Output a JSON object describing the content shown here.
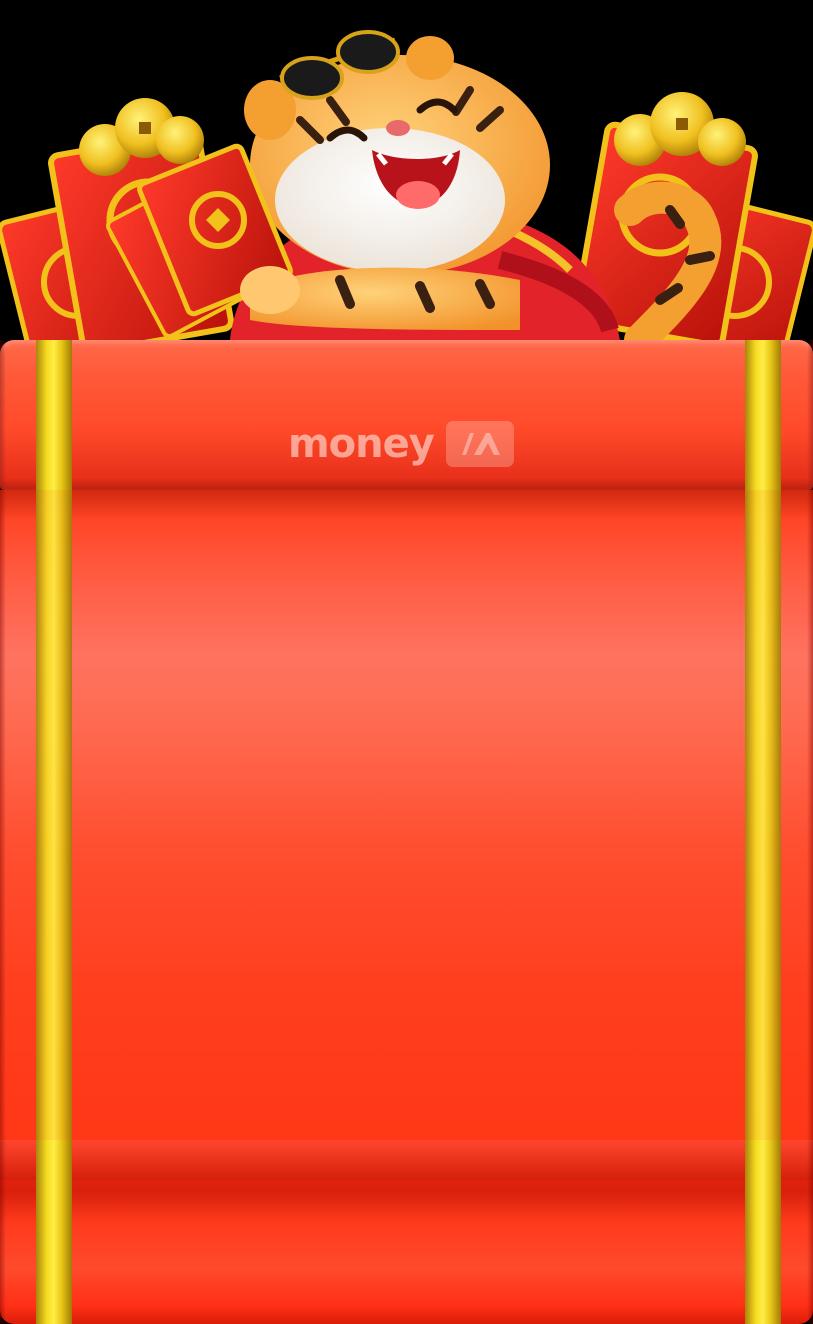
{
  "brand": {
    "word": "money",
    "badge_letters": "IA",
    "word_color": "#ffe8e0"
  },
  "colors": {
    "scroll_red": "#ff4a2a",
    "gold": "#f6dc22",
    "background": "#000000"
  },
  "icons": {
    "mascot": "tiger-icon",
    "envelope": "red-envelope-icon",
    "coins": "gold-coin-icon",
    "sunglasses": "sunglasses-icon",
    "logo": "money-ia-logo"
  }
}
